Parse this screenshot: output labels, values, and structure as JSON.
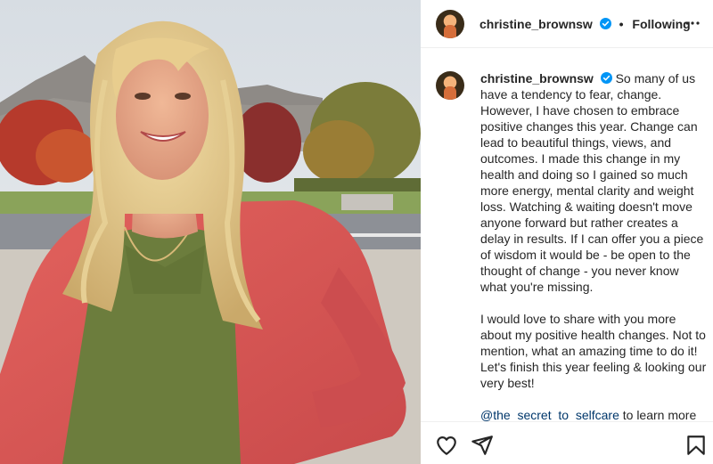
{
  "post": {
    "username": "christine_brownsw",
    "verified": true,
    "dot": "•",
    "follow_status": "Following"
  },
  "caption": {
    "username": "christine_brownsw",
    "paragraph1": "So many of us have a tendency to fear, change. However, I have chosen to embrace positive changes this year. Change can lead to beautiful things, views, and outcomes. I made this change in my health and doing so I gained so much more energy, mental clarity and weight loss. Watching & waiting doesn't move anyone forward but rather creates a delay in results. If I can offer you a piece of wisdom it would be - be open to the thought of change - you never know what you're missing.",
    "paragraph2": "I would love to share with you more about my positive health changes. Not to mention, what an amazing time to do it! Let's finish this year feeling & looking our very best!",
    "mention": "@the_secret_to_selfcare",
    "mention_suffix": "to learn more"
  },
  "icons": {
    "more": "more-horizontal-icon",
    "like": "heart-icon",
    "share": "paper-plane-icon",
    "save": "bookmark-icon",
    "verified": "verified-badge-icon"
  },
  "colors": {
    "verified": "#0095f6",
    "mention": "#00376b",
    "text": "#262626",
    "border": "#efefef"
  }
}
